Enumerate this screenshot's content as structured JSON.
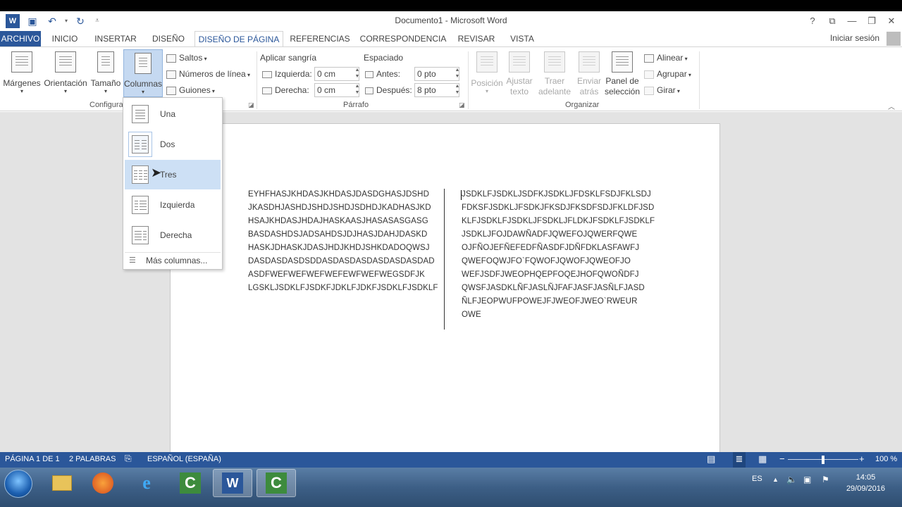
{
  "window": {
    "title": "Documento1 - Microsoft Word",
    "help": "?",
    "sign_in": "Iniciar sesión"
  },
  "tabs": [
    "ARCHIVO",
    "INICIO",
    "INSERTAR",
    "DISEÑO",
    "DISEÑO DE PÁGINA",
    "REFERENCIAS",
    "CORRESPONDENCIA",
    "REVISAR",
    "VISTA"
  ],
  "ribbon": {
    "config": {
      "margenes": "Márgenes",
      "orientacion": "Orientación",
      "tamano": "Tamaño",
      "columnas": "Columnas",
      "saltos": "Saltos",
      "numeros_linea": "Números de línea",
      "guiones": "Guiones",
      "group_label": "Configurar"
    },
    "parrafo": {
      "aplicar_sangria": "Aplicar sangría",
      "espaciado": "Espaciado",
      "izquierda_label": "Izquierda:",
      "izquierda_value": "0 cm",
      "derecha_label": "Derecha:",
      "derecha_value": "0 cm",
      "antes_label": "Antes:",
      "antes_value": "0 pto",
      "despues_label": "Después:",
      "despues_value": "8 pto",
      "group_label": "Párrafo"
    },
    "organizar": {
      "posicion": "Posición",
      "ajustar_1": "Ajustar",
      "ajustar_2": "texto",
      "traer_1": "Traer",
      "traer_2": "adelante",
      "enviar_1": "Enviar",
      "enviar_2": "atrás",
      "panel_1": "Panel de",
      "panel_2": "selección",
      "alinear": "Alinear",
      "agrupar": "Agrupar",
      "girar": "Girar",
      "group_label": "Organizar"
    }
  },
  "columns_menu": {
    "items": [
      "Una",
      "Dos",
      "Tres",
      "Izquierda",
      "Derecha"
    ],
    "selected": "Dos",
    "hovered": "Tres",
    "more": "Más columnas..."
  },
  "document": {
    "col1": [
      "EYHFHASJKHDASJKHDASJDASDGHASJDSHD",
      "JKASDHJASHDJSHDJSHDJSDHDJKADHASJKD",
      "HSAJKHDASJHDAJHASKAASJHASASASGASG",
      "BASDASHDSJADSAHDSJDJHASJDAHJDASKD",
      "HASKJDHASKJDASJHDJKHDJSHKDADOQWSJ",
      "DASDASDASDSDDASDASDASDASDASDASDAD",
      "ASDFWEFWEFWEFWEFEWFWEFWEGSDFJK",
      "LGSKLJSDKLFJSDKFJDKLFJDKFJSDKLFJSDKLF"
    ],
    "col2": [
      "JSDKLFJSDKLJSDFKJSDKLJFDSKLFSDJFKLSDJ",
      "FDKSFJSDKLJFSDKJFKSDJFKSDFSDJFKLDFJSD",
      "KLFJSDKLFJSDKLJFSDKLJFLDKJFSDKLFJSDKLF",
      "JSDKLJFOJDAWÑADFJQWEFOJQWERFQWE",
      "OJFÑOJEFÑEFEDFÑASDFJDÑFDKLASFAWFJ",
      "QWEFOQWJFO`FQWOFJQWOFJQWEOFJO",
      "WEFJSDFJWEOPHQEPFOQEJHOFQWOÑDFJ",
      "QWSFJASDKLÑFJASLÑJFAFJASFJASÑLFJASD",
      "ÑLFJEOPWUFPOWEJFJWEOFJWEO`RWEUR",
      "OWE"
    ]
  },
  "status": {
    "page": "PÁGINA 1 DE 1",
    "words": "2 PALABRAS",
    "language": "ESPAÑOL (ESPAÑA)",
    "zoom": "100 %",
    "zoom_level": 1.0
  },
  "taskbar": {
    "lang": "ES",
    "time": "14:05",
    "date": "29/09/2016"
  },
  "colors": {
    "accent": "#2b579a",
    "hover": "#cde0f5"
  }
}
